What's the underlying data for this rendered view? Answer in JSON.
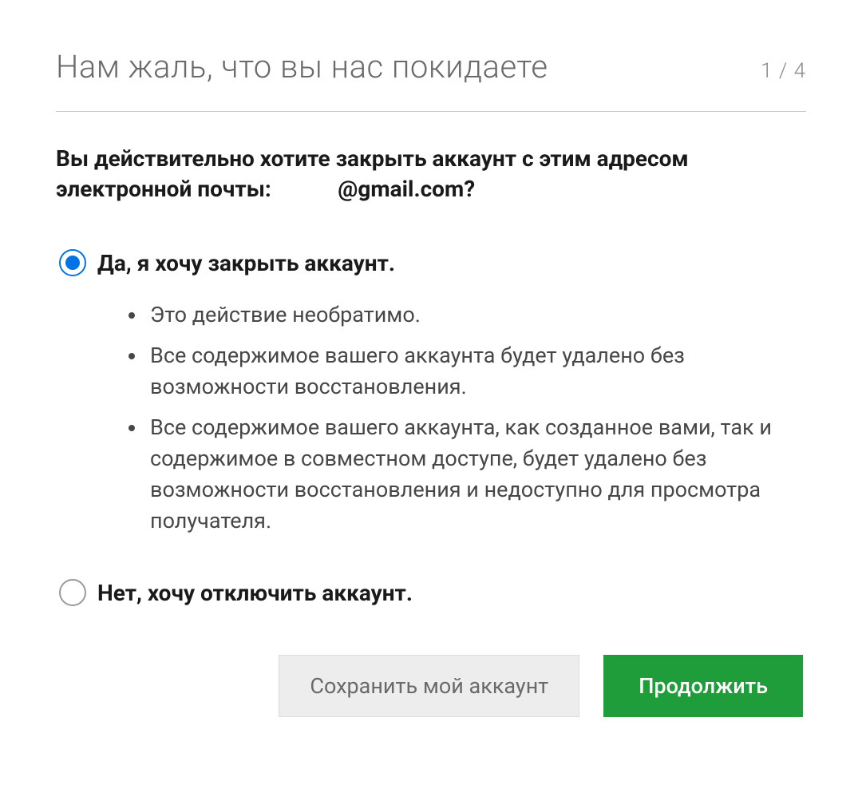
{
  "header": {
    "title": "Нам жаль, что вы нас покидаете",
    "step": "1 / 4"
  },
  "question": "Вы действительно хотите закрыть аккаунт с этим адресом электронной почты:            @gmail.com?",
  "options": {
    "yes": {
      "label": "Да, я хочу закрыть аккаунт.",
      "selected": true,
      "bullets": [
        "Это действие необратимо.",
        "Все содержимое вашего аккаунта будет удалено без возможности восстановления.",
        "Все содержимое вашего аккаунта, как созданное вами, так и содержимое в совместном доступе, будет удалено без возможности восстановления и недоступно для просмотра получателя."
      ]
    },
    "no": {
      "label": "Нет, хочу отключить аккаунт.",
      "selected": false
    }
  },
  "buttons": {
    "keep": "Сохранить мой аккаунт",
    "continue": "Продолжить"
  }
}
